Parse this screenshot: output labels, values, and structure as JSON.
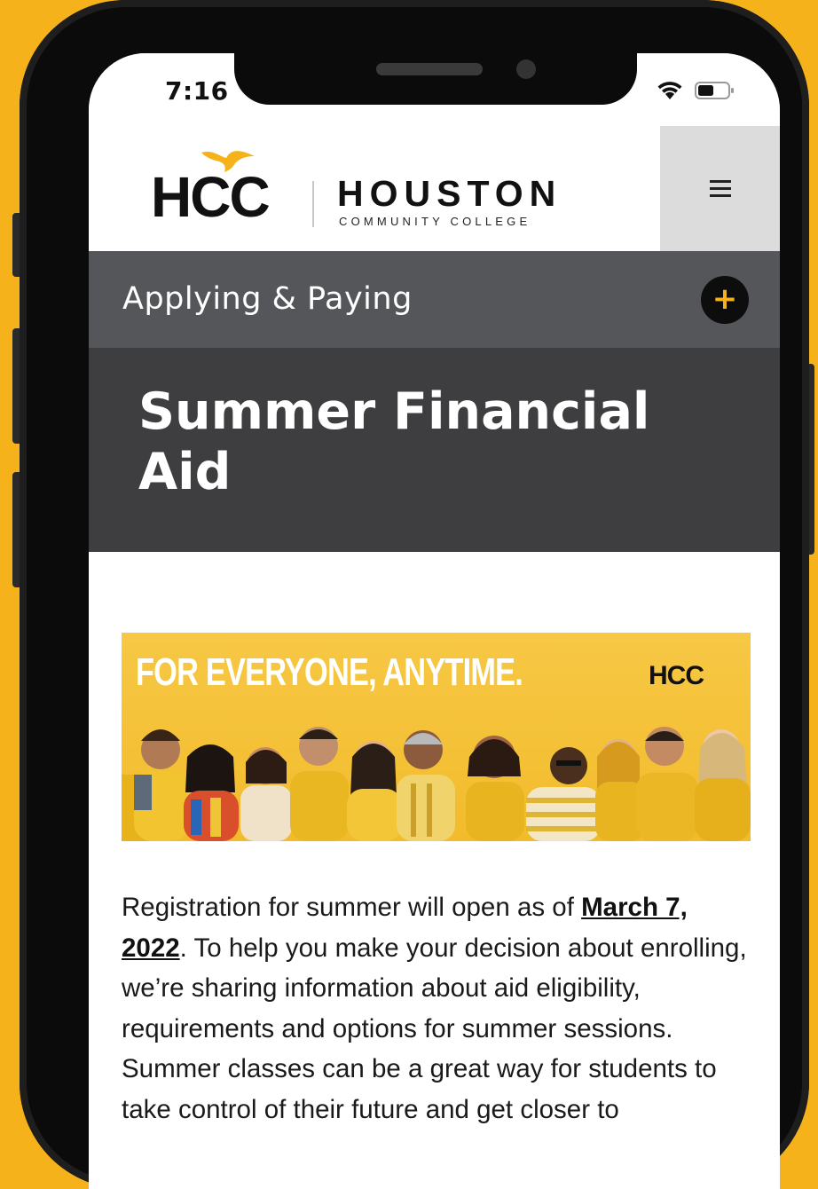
{
  "status_bar": {
    "time": "7:16"
  },
  "header": {
    "logo_mark": "HCC",
    "logo_name": "HOUSTON",
    "logo_subtitle": "COMMUNITY COLLEGE",
    "menu_icon": "hamburger-icon"
  },
  "section": {
    "title": "Applying & Paying",
    "expand_icon": "plus-icon",
    "expand_symbol": "+"
  },
  "hero": {
    "title": "Summer Financial Aid"
  },
  "banner": {
    "headline": "FOR EVERYONE, ANYTIME.",
    "logo": "HCC"
  },
  "content": {
    "intro_before": "Registration for summer will open as of ",
    "date_link": "March 7, 2022",
    "intro_after": ". To help you make your decision about enrolling, we’re sharing information about aid eligibility, requirements and options for summer sessions. Summer classes can be a great way for students to take control of their future and get closer to"
  },
  "colors": {
    "accent": "#F6B21B",
    "section_bar": "#55565a",
    "hero": "#3e3e41"
  }
}
